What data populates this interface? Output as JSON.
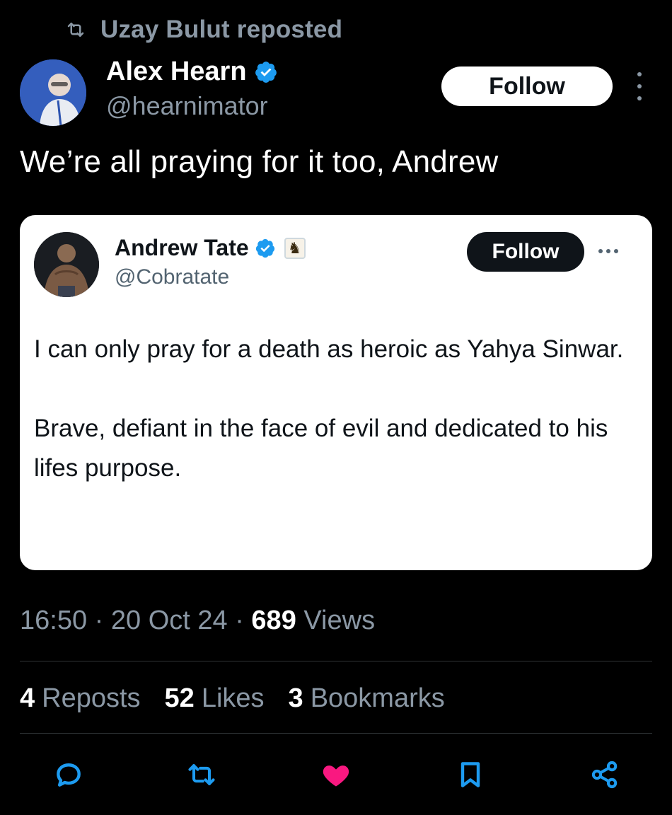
{
  "repost": {
    "label": "Uzay Bulut reposted",
    "icon": "repost-icon"
  },
  "author": {
    "name": "Alex Hearn",
    "handle": "@hearnimator",
    "verified": true,
    "avatar_icon": "profile-photo"
  },
  "follow_label": "Follow",
  "tweet": {
    "text": "We’re all praying for it too, Andrew"
  },
  "quoted": {
    "name": "Andrew Tate",
    "handle": "@Cobratate",
    "verified": true,
    "badge_icon": "chess-knight-icon",
    "follow_label": "Follow",
    "paragraphs": [
      "I can only pray for a death as heroic as Yahya Sinwar.",
      "Brave, defiant in the face of evil and dedicated to his lifes purpose."
    ]
  },
  "meta": {
    "time": "16:50",
    "separator": "·",
    "date": "20 Oct 24",
    "views_count": "689",
    "views_label": "Views"
  },
  "stats": {
    "reposts_count": "4",
    "reposts_label": "Reposts",
    "likes_count": "52",
    "likes_label": "Likes",
    "bookmarks_count": "3",
    "bookmarks_label": "Bookmarks"
  },
  "actions": {
    "reply_icon": "reply-icon",
    "repost_icon": "repost-icon",
    "like_icon": "heart-icon",
    "like_color": "#f91880",
    "bookmark_icon": "bookmark-icon",
    "share_icon": "share-icon"
  },
  "colors": {
    "background": "#000000",
    "verified": "#1d9bf0",
    "muted": "#8b98a5"
  }
}
